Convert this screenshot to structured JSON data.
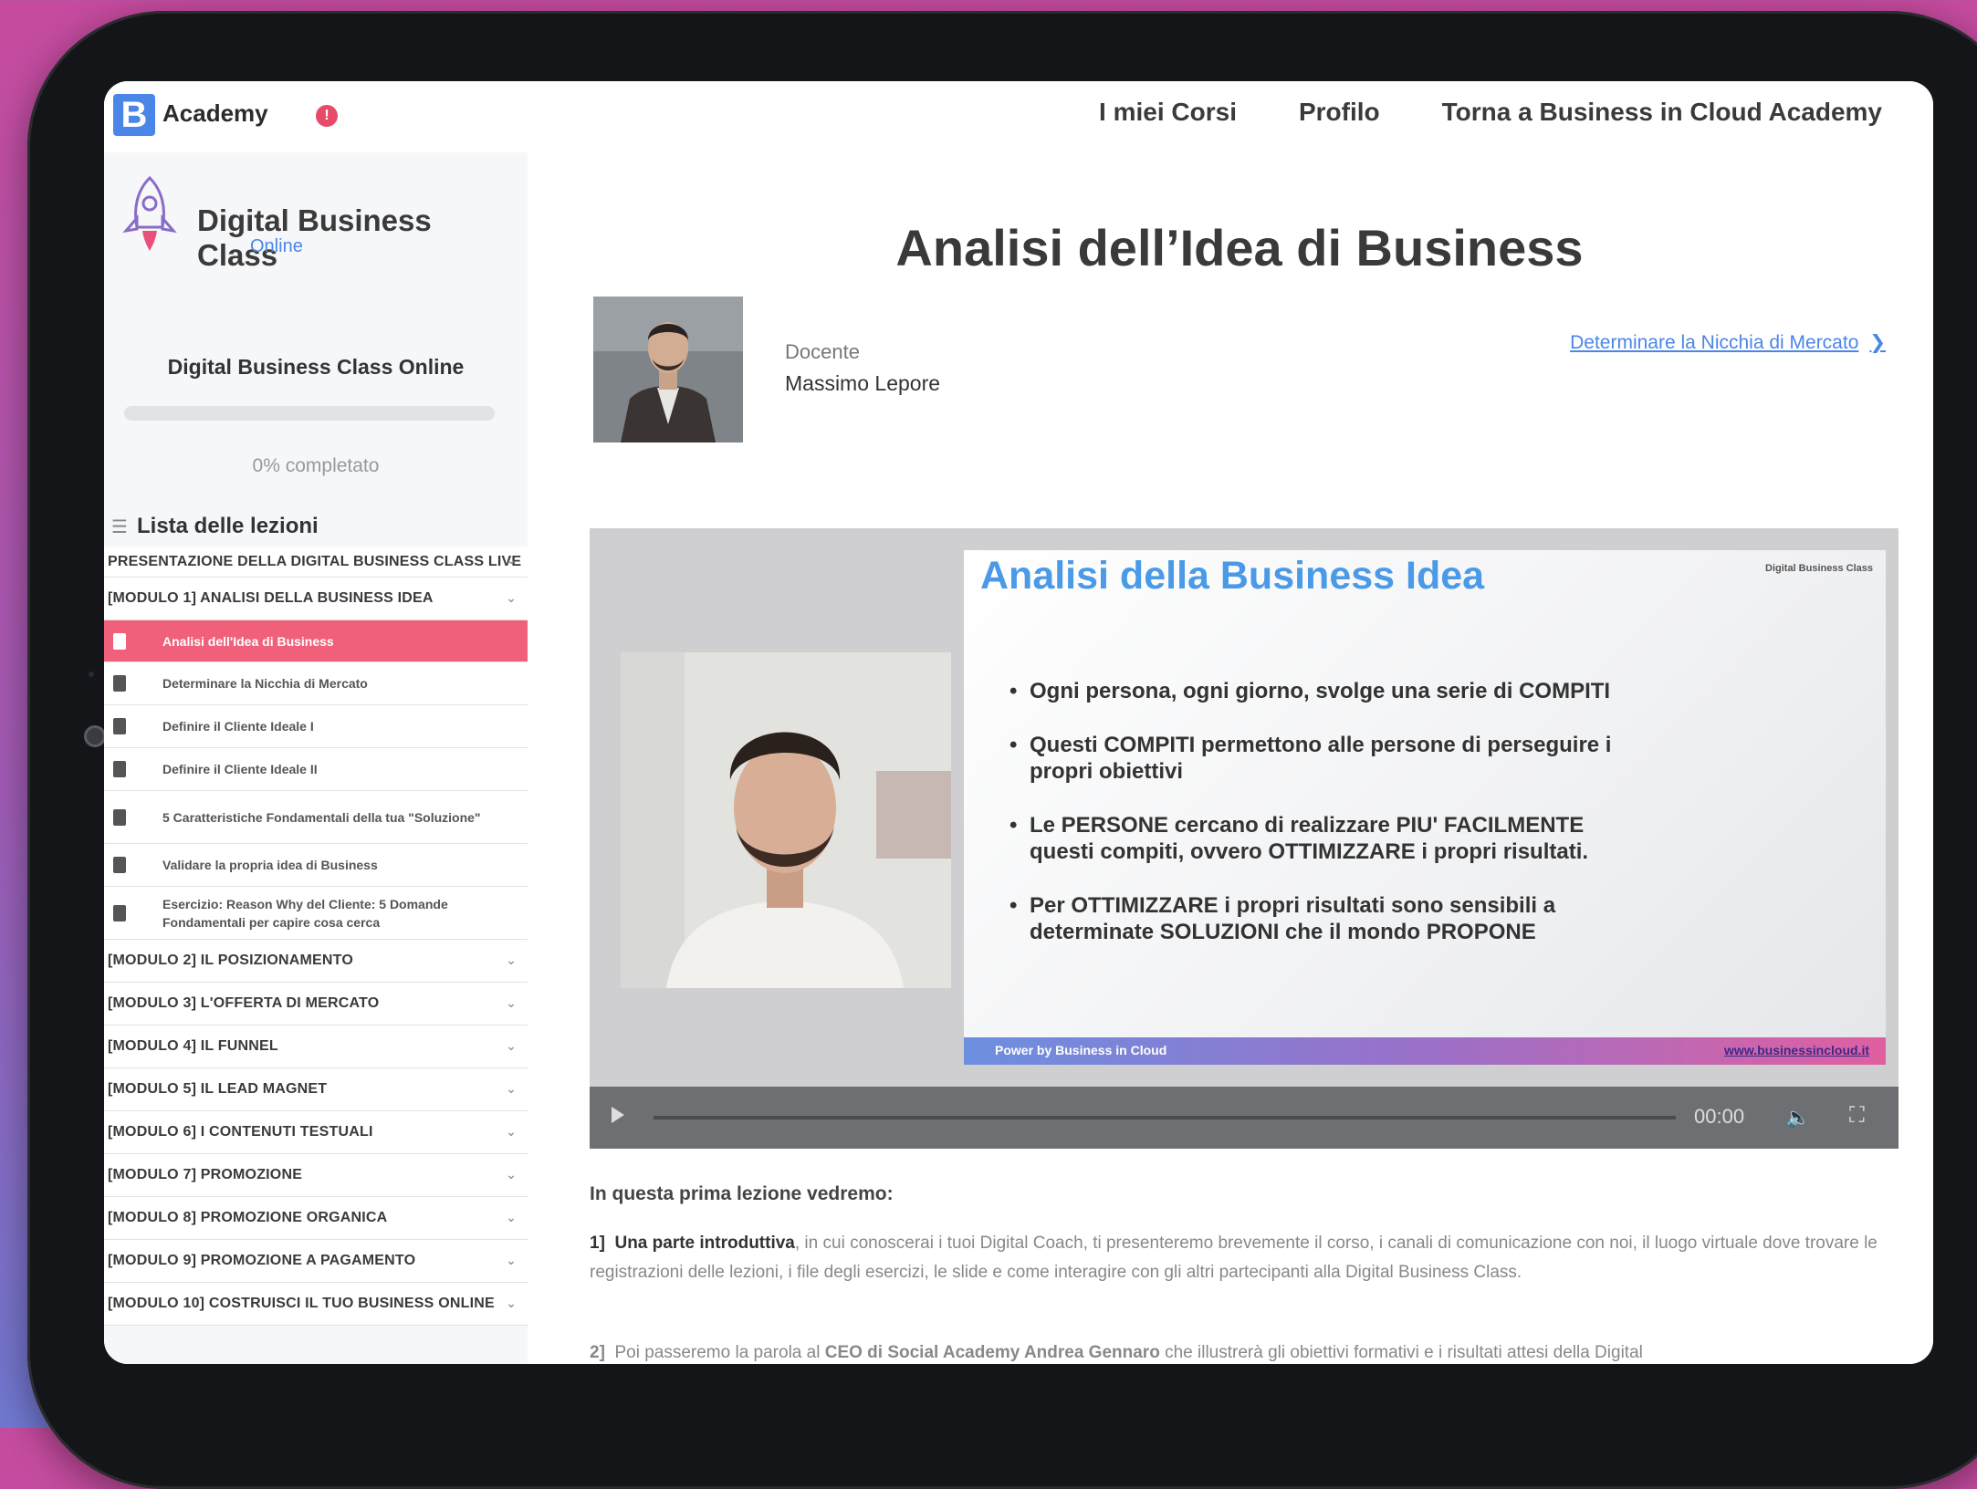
{
  "topbar": {
    "logo_letter": "B",
    "logo_text": "Academy",
    "notification_count": "!",
    "nav": [
      "I miei Corsi",
      "Profilo",
      "Torna a Business in Cloud Academy"
    ]
  },
  "sidebar": {
    "brand_title": "Digital Business Class",
    "brand_sub": "Online",
    "course_title": "Digital Business Class Online",
    "progress_percent": 0,
    "progress_text": "0% completato",
    "lessons_heading": "Lista delle lezioni",
    "items": [
      {
        "type": "module",
        "label": "Presentazione della Digital Business Class Live"
      },
      {
        "type": "module",
        "label": "[MODULO 1] ANALISI DELLA BUSINESS IDEA"
      },
      {
        "type": "lesson",
        "label": "Analisi dell'Idea di Business",
        "active": true
      },
      {
        "type": "lesson",
        "label": "Determinare la Nicchia di Mercato"
      },
      {
        "type": "lesson",
        "label": "Definire il Cliente Ideale I"
      },
      {
        "type": "lesson",
        "label": "Definire il Cliente Ideale II"
      },
      {
        "type": "lesson",
        "label": "5 Caratteristiche Fondamentali della tua \"Soluzione\""
      },
      {
        "type": "lesson",
        "label": "Validare la propria idea di Business"
      },
      {
        "type": "lesson",
        "label": "Esercizio: Reason Why del Cliente: 5 Domande Fondamentali per capire cosa cerca"
      },
      {
        "type": "module",
        "label": "[MODULO 2] IL POSIZIONAMENTO"
      },
      {
        "type": "module",
        "label": "[MODULO 3] L'OFFERTA DI MERCATO"
      },
      {
        "type": "module",
        "label": "[MODULO 4] IL FUNNEL"
      },
      {
        "type": "module",
        "label": "[MODULO 5] IL LEAD MAGNET"
      },
      {
        "type": "module",
        "label": "[MODULO 6] I CONTENUTI TESTUALI"
      },
      {
        "type": "module",
        "label": "[MODULO 7] PROMOZIONE"
      },
      {
        "type": "module",
        "label": "[MODULO 8] PROMOZIONE ORGANICA"
      },
      {
        "type": "module",
        "label": "[MODULO 9] PROMOZIONE A PAGAMENTO"
      },
      {
        "type": "module",
        "label": "[MODULO 10] COSTRUISCI IL TUO BUSINESS ONLINE"
      }
    ]
  },
  "main": {
    "title": "Analisi dell’Idea di Business",
    "teacher_label": "Docente",
    "teacher_name": "Massimo Lepore",
    "next_link": "Determinare la Nicchia di Mercato",
    "video": {
      "slide_title": "Analisi della Business Idea",
      "slide_logo": "Digital Business Class",
      "bullets": [
        "Ogni persona, ogni giorno, svolge una serie di COMPITI",
        "Questi COMPITI permettono alle persone di perseguire i propri obiettivi",
        "Le PERSONE cercano di realizzare PIU' FACILMENTE questi compiti, ovvero OTTIMIZZARE i propri risultati.",
        "Per OTTIMIZZARE i propri risultati sono sensibili a determinate SOLUZIONI che il mondo PROPONE"
      ],
      "footer_left": "Power by Business in Cloud",
      "footer_right": "www.businessincloud.it",
      "time": "00:00"
    },
    "intro": "In questa prima lezione vedremo:",
    "para1_num": "1]",
    "para1_bold": "Una parte introduttiva",
    "para1_rest": ", in cui conoscerai i tuoi Digital Coach, ti presenteremo brevemente il corso, i canali di comunicazione con noi, il luogo virtuale dove trovare le registrazioni delle lezioni, i file degli esercizi, le slide e come interagire con gli altri partecipanti alla Digital Business Class.",
    "para2_num": "2]",
    "para2_start": "Poi passeremo la parola al",
    "para2_bold": "CEO di Social Academy Andrea Gennaro",
    "para2_rest": "che illustrerà gli obiettivi formativi e i risultati attesi della Digital"
  },
  "colors": {
    "accent": "#4a86e8",
    "active_lesson": "#f0607a",
    "notification": "#e84a6a"
  }
}
